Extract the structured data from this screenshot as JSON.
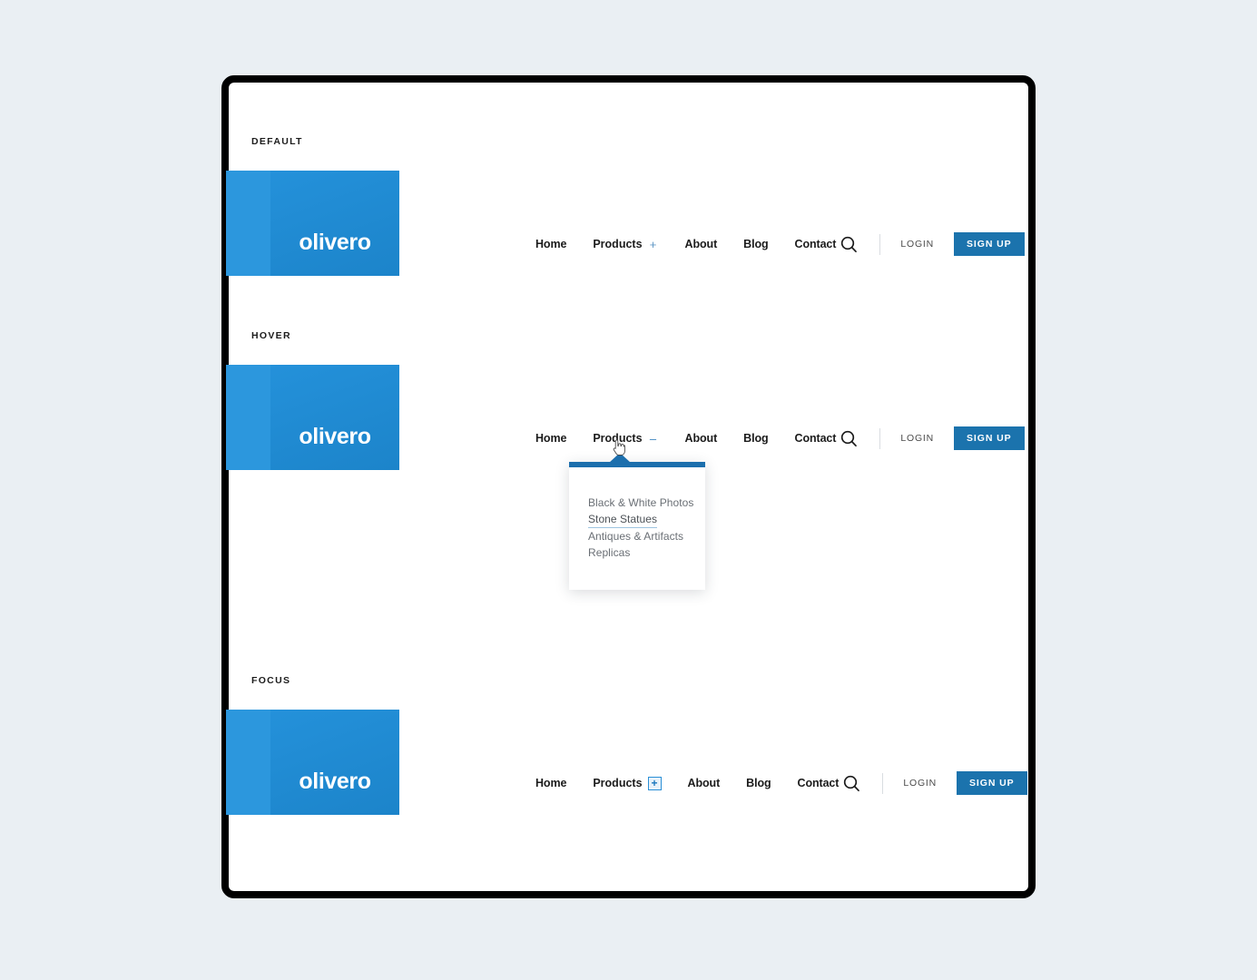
{
  "page": {
    "background_color": "#eaeff3",
    "frame_color": "#000000",
    "accent_blue": "#1b73ad",
    "logo_blue_light": "#2c97dd",
    "logo_blue_dark": "#1c84ca"
  },
  "sections": [
    {
      "label": "DEFAULT"
    },
    {
      "label": "HOVER"
    },
    {
      "label": "FOCUS"
    }
  ],
  "logo": {
    "word": "olivero"
  },
  "nav": {
    "links": [
      {
        "label": "Home"
      },
      {
        "label": "About"
      },
      {
        "label": "Blog"
      },
      {
        "label": "Contact"
      }
    ],
    "products": {
      "label": "Products"
    },
    "toggle_default": "+",
    "toggle_hover": "–",
    "toggle_focus": "+",
    "search_icon": "search-icon",
    "login_label": "LOGIN",
    "signup_label": "SIGN UP"
  },
  "dropdown": {
    "items": [
      {
        "label": "Black & White Photos",
        "state": "default"
      },
      {
        "label": "Stone Statues",
        "state": "hover"
      },
      {
        "label": "Antiques & Artifacts",
        "state": "default"
      },
      {
        "label": "Replicas",
        "state": "default"
      }
    ]
  },
  "cursor": {
    "icon": "pointer-hand-cursor"
  }
}
